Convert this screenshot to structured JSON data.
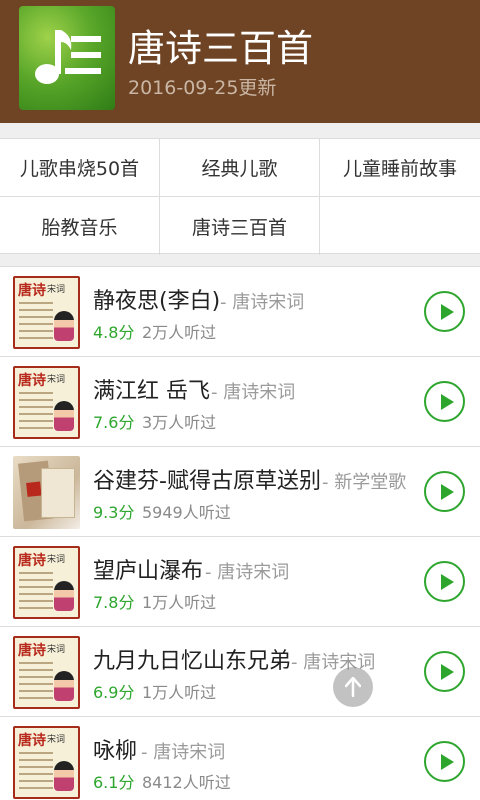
{
  "header": {
    "title": "唐诗三百首",
    "subtitle": "2016-09-25更新"
  },
  "categories": [
    {
      "label": "儿歌串烧50首"
    },
    {
      "label": "经典儿歌"
    },
    {
      "label": "儿童睡前故事"
    },
    {
      "label": "胎教音乐"
    },
    {
      "label": "唐诗三百首"
    }
  ],
  "songs": [
    {
      "title": "静夜思(李白)",
      "category": "- 唐诗宋词",
      "score": "4.8分",
      "listens": "2万人听过",
      "thumb_text": "唐诗",
      "thumb_sub": "宋词"
    },
    {
      "title": "满江红 岳飞",
      "category": "- 唐诗宋词",
      "score": "7.6分",
      "listens": "3万人听过",
      "thumb_text": "唐诗",
      "thumb_sub": "宋词"
    },
    {
      "title": "谷建芬-赋得古原草送别",
      "category": "- 新学堂歌",
      "score": "9.3分",
      "listens": "5949人听过",
      "thumb_text": "",
      "thumb_sub": ""
    },
    {
      "title": "望庐山瀑布",
      "category": "- 唐诗宋词",
      "score": "7.8分",
      "listens": "1万人听过",
      "thumb_text": "唐诗",
      "thumb_sub": "宋词"
    },
    {
      "title": "九月九日忆山东兄弟",
      "category": "- 唐诗宋词",
      "score": "6.9分",
      "listens": "1万人听过",
      "thumb_text": "唐诗",
      "thumb_sub": "宋词"
    },
    {
      "title": "咏柳",
      "category": "- 唐诗宋词",
      "score": "6.1分",
      "listens": "8412人听过",
      "thumb_text": "唐诗",
      "thumb_sub": "宋词"
    }
  ],
  "colors": {
    "header_bg": "#6e4424",
    "accent_green": "#2ea62e"
  },
  "icons": {
    "app": "music-note-icon",
    "play": "play-icon",
    "scroll_top": "arrow-up-icon"
  }
}
